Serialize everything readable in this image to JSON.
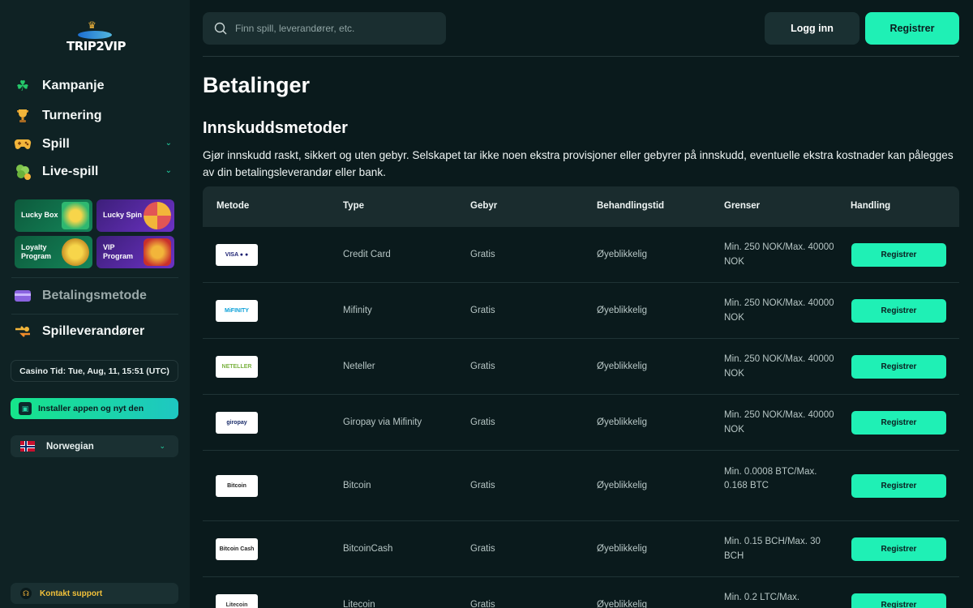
{
  "sidebar": {
    "logo_text": "TRIP2VIP",
    "items": [
      {
        "label": "Kampanje",
        "icon": "clover-icon"
      },
      {
        "label": "Turnering",
        "icon": "trophy-icon"
      },
      {
        "label": "Spill",
        "icon": "gamepad-icon"
      },
      {
        "label": "Live-spill",
        "icon": "live-clover-icon"
      }
    ],
    "promos": [
      {
        "label": "Lucky Box",
        "icon": "gift-icon",
        "color": "#0f6b47"
      },
      {
        "label": "Lucky Spin",
        "icon": "wheel-icon",
        "color": "#5a2aa8"
      },
      {
        "label": "Loyalty Program",
        "icon": "coin-icon",
        "color": "#0f6b47"
      },
      {
        "label": "VIP Program",
        "icon": "crown-icon",
        "color": "#5a2aa8"
      }
    ],
    "payment_method": "Betalingsmetode",
    "providers": "Spilleverandører",
    "casino_time": "Casino Tid: Tue, Aug, 11, 15:51 (UTC)",
    "install_app": "Installer appen og nyt den",
    "language": "Norwegian",
    "support": "Kontakt support"
  },
  "header": {
    "search_placeholder": "Finn spill, leverandører, etc.",
    "login": "Logg inn",
    "register": "Registrer"
  },
  "main": {
    "title": "Betalinger",
    "section_title": "Innskuddsmetoder",
    "description": "Gjør innskudd raskt, sikkert og uten gebyr. Selskapet tar ikke noen ekstra provisjoner eller gebyrer på innskudd, eventuelle ekstra kostnader kan pålegges av din betalingsleverandør eller bank.",
    "table": {
      "headers": [
        "Metode",
        "Type",
        "Gebyr",
        "Behandlingstid",
        "Grenser",
        "Handling"
      ],
      "rows": [
        {
          "logo": "VISA ● ●",
          "type": "Credit Card",
          "fee": "Gratis",
          "time": "Øyeblikkelig",
          "limits": "Min. 250 NOK/Max. 40000 NOK",
          "action": "Registrer"
        },
        {
          "logo": "MiFINITY",
          "type": "Mifinity",
          "fee": "Gratis",
          "time": "Øyeblikkelig",
          "limits": "Min. 250 NOK/Max. 40000 NOK",
          "action": "Registrer"
        },
        {
          "logo": "NETELLER",
          "type": "Neteller",
          "fee": "Gratis",
          "time": "Øyeblikkelig",
          "limits": "Min. 250 NOK/Max. 40000 NOK",
          "action": "Registrer"
        },
        {
          "logo": "giropay",
          "type": "Giropay via Mifinity",
          "fee": "Gratis",
          "time": "Øyeblikkelig",
          "limits": "Min. 250 NOK/Max. 40000 NOK",
          "action": "Registrer"
        },
        {
          "logo": "Bitcoin",
          "type": "Bitcoin",
          "fee": "Gratis",
          "time": "Øyeblikkelig",
          "limits": "Min. 0.0008 BTC/Max. 0.168 BTC",
          "action": "Registrer"
        },
        {
          "logo": "Bitcoin Cash",
          "type": "BitcoinCash",
          "fee": "Gratis",
          "time": "Øyeblikkelig",
          "limits": "Min. 0.15 BCH/Max. 30 BCH",
          "action": "Registrer"
        },
        {
          "logo": "Litecoin",
          "type": "Litecoin",
          "fee": "Gratis",
          "time": "Øyeblikkelig",
          "limits": "Min. 0.2 LTC/Max.",
          "action": "Registrer"
        }
      ]
    }
  },
  "colors": {
    "accent": "#1ff0b5",
    "sidebar": "#0f2224",
    "background": "#0a1a1c"
  }
}
